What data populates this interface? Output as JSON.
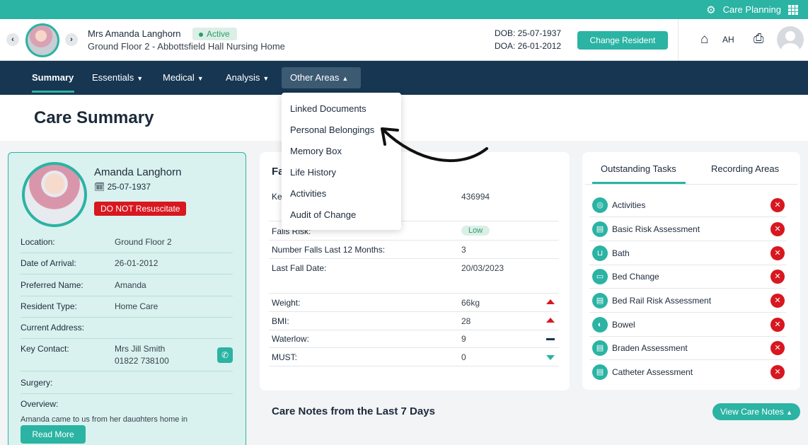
{
  "topbar": {
    "label": "Care Planning",
    "gear_icon": "gear-icon",
    "apps_icon": "grid-icon"
  },
  "resident": {
    "name": "Mrs Amanda Langhorn",
    "status": "Active",
    "location": "Ground Floor 2 - Abbottsfield Hall Nursing Home",
    "dob": "DOB: 25-07-1937",
    "doa": "DOA: 26-01-2012",
    "change_button": "Change Resident"
  },
  "user": {
    "initials": "AH"
  },
  "nav": {
    "items": [
      {
        "label": "Summary"
      },
      {
        "label": "Essentials"
      },
      {
        "label": "Medical"
      },
      {
        "label": "Analysis"
      },
      {
        "label": "Other Areas"
      }
    ]
  },
  "dropdown": {
    "items": [
      "Linked Documents",
      "Personal Belongings",
      "Memory Box",
      "Life History",
      "Activities",
      "Audit of Change"
    ]
  },
  "page": {
    "title": "Care Summary"
  },
  "profile": {
    "name": "Amanda Langhorn",
    "dob": "25-07-1937",
    "dnr": "DO NOT Resuscitate",
    "fields": [
      {
        "label": "Location:",
        "value": "Ground Floor 2"
      },
      {
        "label": "Date of Arrival:",
        "value": "26-01-2012"
      },
      {
        "label": "Preferred Name:",
        "value": "Amanda"
      },
      {
        "label": "Resident Type:",
        "value": "Home Care"
      },
      {
        "label": "Current Address:",
        "value": ""
      },
      {
        "label": "Key Contact:",
        "value": "Mrs Jill Smith",
        "value2": "01822 738100"
      },
      {
        "label": "Surgery:",
        "value": ""
      },
      {
        "label": "Overview:",
        "value": ""
      }
    ],
    "overview_text": "Amanda came to us from her daughters home in",
    "read_more": "Read More"
  },
  "summary": {
    "title_partial": "Fa",
    "key_label_partial": "Ke",
    "key_value": "436994",
    "rows": [
      {
        "label": "Falls Risk:",
        "value": "Low",
        "badge": true
      },
      {
        "label": "Number Falls Last 12 Months:",
        "value": "3"
      },
      {
        "label": "Last Fall Date:",
        "value": "20/03/2023"
      },
      {
        "label": "Weight:",
        "value": "66kg",
        "trend": "up"
      },
      {
        "label": "BMI:",
        "value": "28",
        "trend": "up"
      },
      {
        "label": "Waterlow:",
        "value": "9",
        "trend": "flat"
      },
      {
        "label": "MUST:",
        "value": "0",
        "trend": "down"
      }
    ]
  },
  "tasks": {
    "tab_outstanding": "Outstanding Tasks",
    "tab_recording": "Recording Areas",
    "items": [
      "Activities",
      "Basic Risk Assessment",
      "Bath",
      "Bed Change",
      "Bed Rail Risk Assessment",
      "Bowel",
      "Braden Assessment",
      "Catheter Assessment"
    ]
  },
  "care_notes": {
    "title": "Care Notes from the Last 7 Days",
    "button": "View Care Notes"
  },
  "colors": {
    "teal": "#2bb3a3",
    "navy": "#163651",
    "danger": "#d8171f"
  }
}
